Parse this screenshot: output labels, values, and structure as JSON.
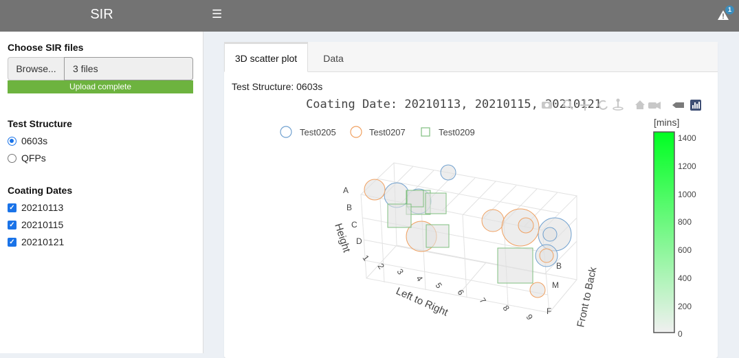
{
  "app": {
    "title": "SIR",
    "menu_icon": "hamburger-icon",
    "alert_icon": "warning-icon",
    "alert_count": "1"
  },
  "sidebar": {
    "file_label": "Choose SIR files",
    "browse_label": "Browse...",
    "file_value": "3 files",
    "upload_status": "Upload complete",
    "upload_progress": 1.0,
    "structure_label": "Test Structure",
    "structures": [
      {
        "label": "0603s",
        "selected": true
      },
      {
        "label": "QFPs",
        "selected": false
      }
    ],
    "dates_label": "Coating Dates",
    "dates": [
      {
        "label": "20210113",
        "checked": true
      },
      {
        "label": "20210115",
        "checked": true
      },
      {
        "label": "20210121",
        "checked": true
      }
    ]
  },
  "main": {
    "tabs": [
      {
        "label": "3D scatter plot",
        "active": true
      },
      {
        "label": "Data",
        "active": false
      }
    ],
    "subtitle": "Test Structure: 0603s",
    "modebar_icons": [
      "camera-icon",
      "zoom-icon",
      "pan-icon",
      "orbit-icon",
      "turntable-icon",
      "home-icon",
      "camera-view-icon",
      "hover-icon",
      "plotly-logo-icon"
    ]
  },
  "chart_data": {
    "type": "scatter",
    "title": "Coating Date: 20210113, 20210115, 20210121",
    "axes": {
      "x": {
        "label": "Left to Right",
        "ticks": [
          "1",
          "2",
          "3",
          "4",
          "5",
          "6",
          "7",
          "8",
          "9"
        ]
      },
      "y": {
        "label": "Front to Back",
        "ticks": [
          "B",
          "M",
          "F"
        ]
      },
      "z": {
        "label": "Height",
        "ticks": [
          "A",
          "B",
          "C",
          "D"
        ]
      }
    },
    "legend": {
      "placement": "top-left",
      "entries": [
        {
          "name": "Test0205",
          "symbol": "circle",
          "color": "#6fa0cf"
        },
        {
          "name": "Test0207",
          "symbol": "circle",
          "color": "#f0a060"
        },
        {
          "name": "Test0209",
          "symbol": "square",
          "color": "#7fbf7f"
        }
      ]
    },
    "colorbar": {
      "title": "[mins]",
      "ticks": [
        "1400",
        "1200",
        "1000",
        "800",
        "600",
        "400",
        "200",
        "0"
      ],
      "range": [
        0,
        1500
      ],
      "color_low": "#f0f0f0",
      "color_high": "#00ff22"
    },
    "series": [
      {
        "name": "Test0205",
        "points": [
          {
            "x": 4,
            "y": "F",
            "z": "A"
          },
          {
            "x": 3,
            "y": "M",
            "z": "B"
          },
          {
            "x": 4,
            "y": "M",
            "z": "B"
          },
          {
            "x": 9,
            "y": "B",
            "z": "C"
          },
          {
            "x": 9,
            "y": "B",
            "z": "D"
          },
          {
            "x": 9,
            "y": "B",
            "z": "D"
          }
        ]
      },
      {
        "name": "Test0207",
        "points": [
          {
            "x": 2,
            "y": "M",
            "z": "B"
          },
          {
            "x": 3,
            "y": "M",
            "z": "D"
          },
          {
            "x": 7,
            "y": "B",
            "z": "C"
          },
          {
            "x": 8,
            "y": "B",
            "z": "C"
          },
          {
            "x": 9,
            "y": "B",
            "z": "D"
          },
          {
            "x": 8,
            "y": "F",
            "z": "D"
          }
        ]
      },
      {
        "name": "Test0209",
        "points": [
          {
            "x": 3,
            "y": "M",
            "z": "B"
          },
          {
            "x": 4,
            "y": "M",
            "z": "B"
          },
          {
            "x": 4,
            "y": "M",
            "z": "B"
          },
          {
            "x": 2,
            "y": "M",
            "z": "C"
          },
          {
            "x": 4,
            "y": "M",
            "z": "D"
          },
          {
            "x": 7,
            "y": "F",
            "z": "D"
          }
        ]
      }
    ]
  }
}
